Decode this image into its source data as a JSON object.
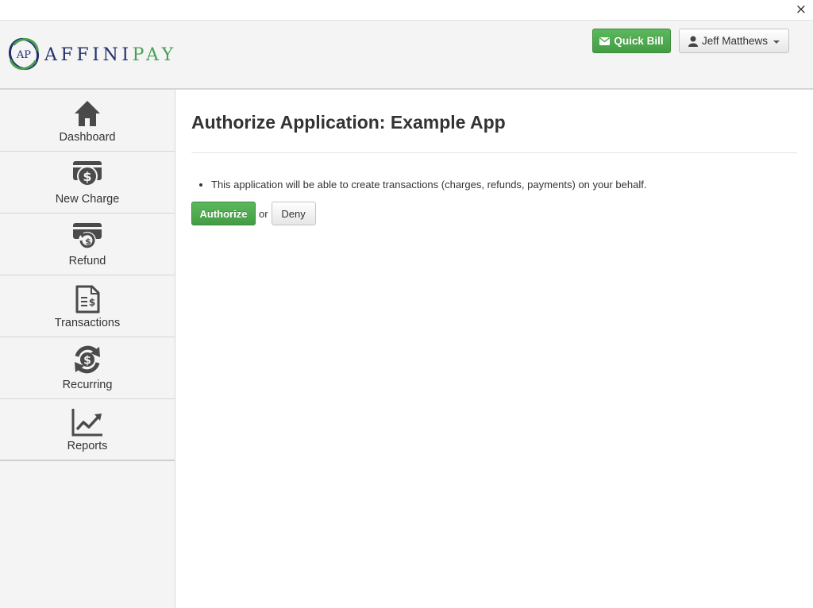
{
  "window": {
    "close_glyph": "×"
  },
  "header": {
    "logo": {
      "monogram": "AP",
      "word_part1": "AFFINI",
      "word_part2": "PAY",
      "colors": {
        "navy": "#23306b",
        "green": "#47a052"
      }
    },
    "quick_bill": {
      "label": "Quick Bill",
      "icon": "envelope-icon"
    },
    "user_menu": {
      "label": "Jeff Matthews",
      "icon": "user-icon"
    }
  },
  "sidebar": {
    "items": [
      {
        "label": "Dashboard",
        "icon": "home-icon"
      },
      {
        "label": "New Charge",
        "icon": "card-dollar-icon"
      },
      {
        "label": "Refund",
        "icon": "card-refund-icon"
      },
      {
        "label": "Transactions",
        "icon": "document-dollar-icon"
      },
      {
        "label": "Recurring",
        "icon": "recurring-dollar-icon"
      },
      {
        "label": "Reports",
        "icon": "line-chart-icon"
      }
    ]
  },
  "main": {
    "title": "Authorize Application: Example App",
    "permissions": [
      "This application will be able to create transactions (charges, refunds, payments) on your behalf."
    ],
    "authorize_label": "Authorize",
    "or_text": "or",
    "deny_label": "Deny"
  },
  "colors": {
    "accent_green": "#5cb85c",
    "sidebar_bg": "#f4f4f4",
    "icon": "#4a4a4a"
  }
}
